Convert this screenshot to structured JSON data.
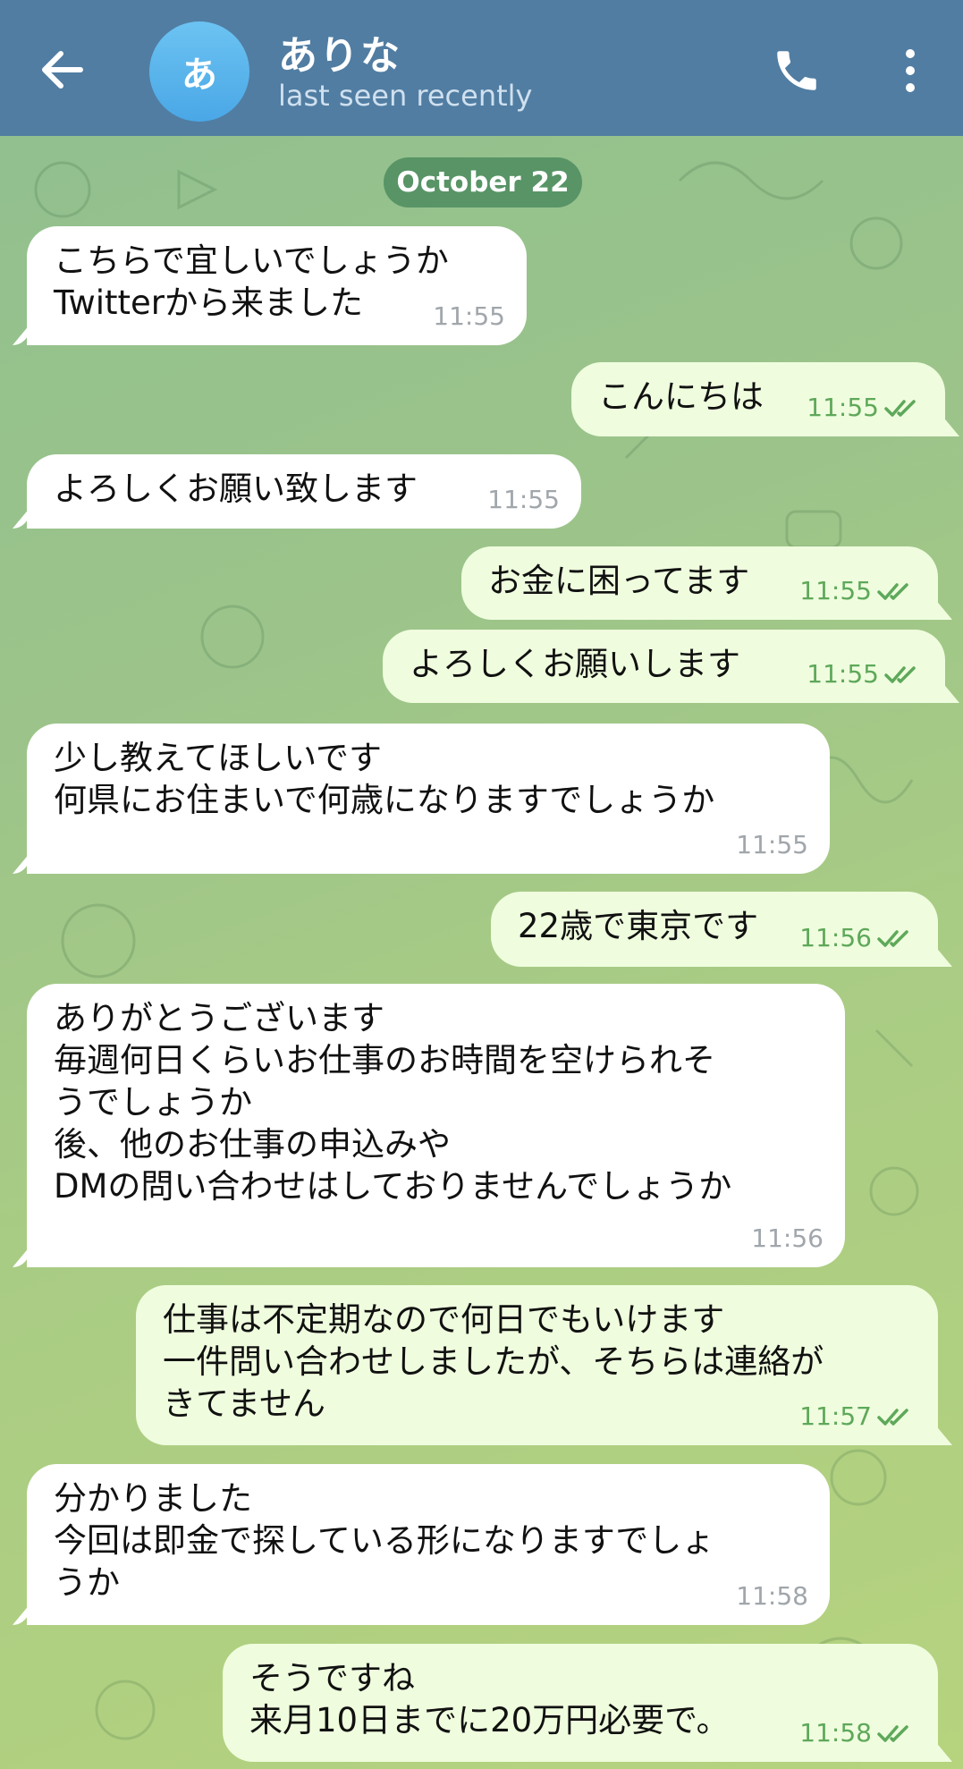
{
  "header": {
    "avatar_letter": "あ",
    "name": "ありな",
    "status": "last seen recently"
  },
  "date_separator": "October 22",
  "messages": [
    {
      "dir": "in",
      "text": "こちらで宜しいでしょうか\nTwitterから来ました",
      "time": "11:55"
    },
    {
      "dir": "out",
      "text": "こんにちは",
      "time": "11:55"
    },
    {
      "dir": "in",
      "text": "よろしくお願い致します",
      "time": "11:55"
    },
    {
      "dir": "out",
      "text": "お金に困ってます",
      "time": "11:55"
    },
    {
      "dir": "out",
      "text": "よろしくお願いします",
      "time": "11:55"
    },
    {
      "dir": "in",
      "text": "少し教えてほしいです\n何県にお住まいで何歳になりますでしょうか",
      "time": "11:55"
    },
    {
      "dir": "out",
      "text": "22歳で東京です",
      "time": "11:56"
    },
    {
      "dir": "in",
      "text": "ありがとうございます\n毎週何日くらいお仕事のお時間を空けられそ\nうでしょうか\n後、他のお仕事の申込みや\nDMの問い合わせはしておりませんでしょうか",
      "time": "11:56"
    },
    {
      "dir": "out",
      "text": "仕事は不定期なので何日でもいけます\n一件問い合わせしましたが、そちらは連絡が\nきてません",
      "time": "11:57"
    },
    {
      "dir": "in",
      "text": "分かりました\n今回は即金で探している形になりますでしょ\nうか",
      "time": "11:58"
    },
    {
      "dir": "out",
      "text": "そうですね\n来月10日までに20万円必要で。",
      "time": "11:58"
    }
  ],
  "icons": {
    "back": "arrow-left-icon",
    "call": "phone-icon",
    "more": "more-vertical-icon",
    "read": "double-check-icon"
  },
  "colors": {
    "header": "#517da2",
    "incoming": "#ffffff",
    "outgoing": "#effdde",
    "tick": "#5ea85a",
    "date_pill": "#4d8c5f"
  }
}
